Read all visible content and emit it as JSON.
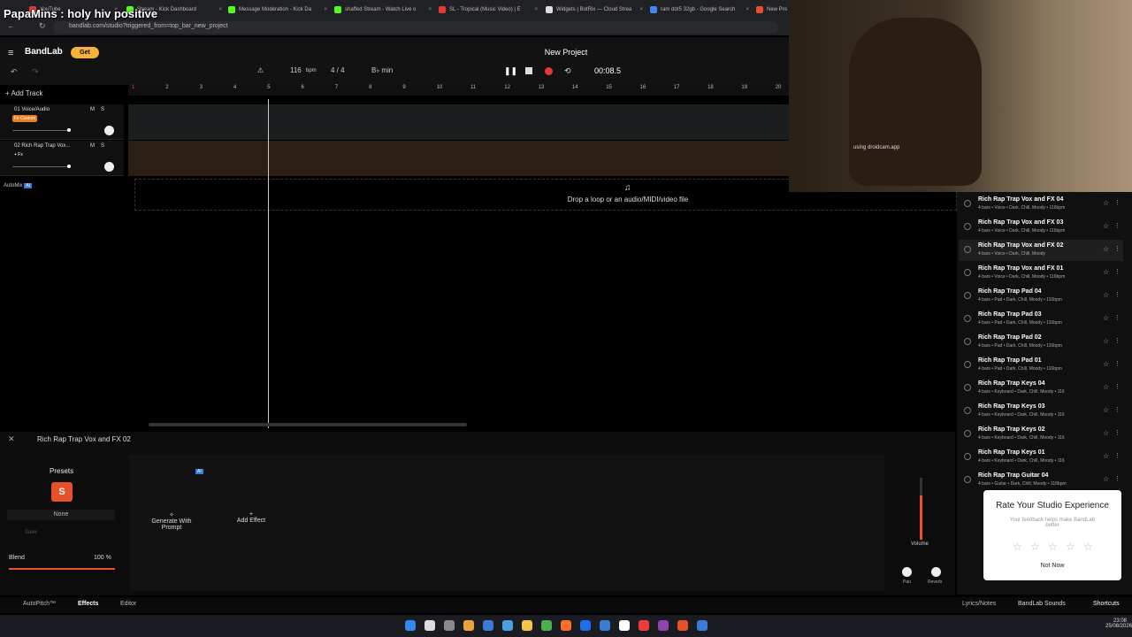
{
  "browser": {
    "tabs": [
      {
        "label": "YouTube",
        "color": "#e53935"
      },
      {
        "label": "Stream - Kick Dashboard",
        "color": "#53fc18"
      },
      {
        "label": "Message Moderation - Kick Da",
        "color": "#53fc18"
      },
      {
        "label": "shaffed Stream - Watch Live o",
        "color": "#53fc18"
      },
      {
        "label": "SL - Tropical (Music Video) | E",
        "color": "#e53935"
      },
      {
        "label": "Widgets | BotRix — Cloud Strea",
        "color": "#dddddd"
      },
      {
        "label": "ram ddr5 32gb - Google Search",
        "color": "#4285f4"
      },
      {
        "label": "New Pro",
        "color": "#e8502a"
      }
    ],
    "url": "bandlab.com/studio?triggered_from=top_bar_new_project"
  },
  "overlay": {
    "stream_title": "PapaMins : holy hiv positive"
  },
  "app": {
    "logo": "BandLab",
    "get_label": "Get",
    "project_title": "New Project",
    "tempo": "116",
    "tempo_unit": "bpm",
    "time_sig": "4 / 4",
    "key": "B♭ min",
    "time": "00:08.5",
    "add_track": "Add Track",
    "ruler": [
      "1",
      "2",
      "3",
      "4",
      "5",
      "6",
      "7",
      "8",
      "9",
      "10",
      "11",
      "12",
      "13",
      "14",
      "15",
      "16",
      "17",
      "18",
      "19",
      "20"
    ],
    "tracks": [
      {
        "name": "01  Voice/Audio",
        "badge": "Fx Custom"
      },
      {
        "name": "02  Rich Rap Trap Vox...",
        "badge": "+ Fx"
      }
    ],
    "automix": "AutoMix",
    "automix_badge": "AI",
    "drop_label": "Drop a loop or an audio/MIDI/video file",
    "selected_track": "Rich Rap Trap Vox and FX 02",
    "presets_label": "Presets",
    "preset_letter": "S",
    "preset_none": "None",
    "save_label": "Save",
    "blend_label": "Blend",
    "blend_value": "100 %",
    "generate_label": "Generate With Prompt",
    "generate_badge": "AI",
    "add_effect": "Add Effect",
    "volume_label": "Volume",
    "pan_label": "Pan",
    "reverb_label": "Reverb",
    "footer": {
      "autopitch": "AutoPitch™",
      "effects": "Effects",
      "editor": "Editor",
      "lyrics": "Lyrics/Notes",
      "sounds": "BandLab Sounds",
      "shortcuts": "Shortcuts"
    }
  },
  "webcam": {
    "watermark": "using droidcam.app"
  },
  "sidebar": {
    "items": [
      {
        "title": "Rich Rap Trap Vox and FX 04",
        "meta": "4 bars • Voice • Dark, Chill, Moody • 116bpm"
      },
      {
        "title": "Rich Rap Trap Vox and FX 03",
        "meta": "4 bars • Voice • Dark, Chill, Moody • 116bpm"
      },
      {
        "title": "Rich Rap Trap Vox and FX 02",
        "meta": "4 bars • Voice • Dark, Chill, Moody"
      },
      {
        "title": "Rich Rap Trap Vox and FX 01",
        "meta": "4 bars • Voice • Dark, Chill, Moody • 116bpm"
      },
      {
        "title": "Rich Rap Trap Pad 04",
        "meta": "4 bars • Pad • Dark, Chill, Moody • 116bpm"
      },
      {
        "title": "Rich Rap Trap Pad 03",
        "meta": "4 bars • Pad • Dark, Chill, Moody • 116bpm"
      },
      {
        "title": "Rich Rap Trap Pad 02",
        "meta": "4 bars • Pad • Dark, Chill, Moody • 116bpm"
      },
      {
        "title": "Rich Rap Trap Pad 01",
        "meta": "4 bars • Pad • Dark, Chill, Moody • 116bpm"
      },
      {
        "title": "Rich Rap Trap Keys 04",
        "meta": "4 bars • Keyboard • Dark, Chill, Moody • 116"
      },
      {
        "title": "Rich Rap Trap Keys 03",
        "meta": "4 bars • Keyboard • Dark, Chill, Moody • 116"
      },
      {
        "title": "Rich Rap Trap Keys 02",
        "meta": "4 bars • Keyboard • Dark, Chill, Moody • 116"
      },
      {
        "title": "Rich Rap Trap Keys 01",
        "meta": "4 bars • Keyboard • Dark, Chill, Moody • 116"
      },
      {
        "title": "Rich Rap Trap Guitar 04",
        "meta": "4 bars • Guitar • Dark, Chill, Moody • 116bpm"
      }
    ]
  },
  "rating": {
    "title": "Rate Your Studio Experience",
    "subtitle": "Your feedback helps make BandLab better",
    "not_now": "Not Now",
    "stars": "☆"
  },
  "system": {
    "time": "23:08",
    "date": "25/08/2026"
  },
  "accent": "#e8502a"
}
